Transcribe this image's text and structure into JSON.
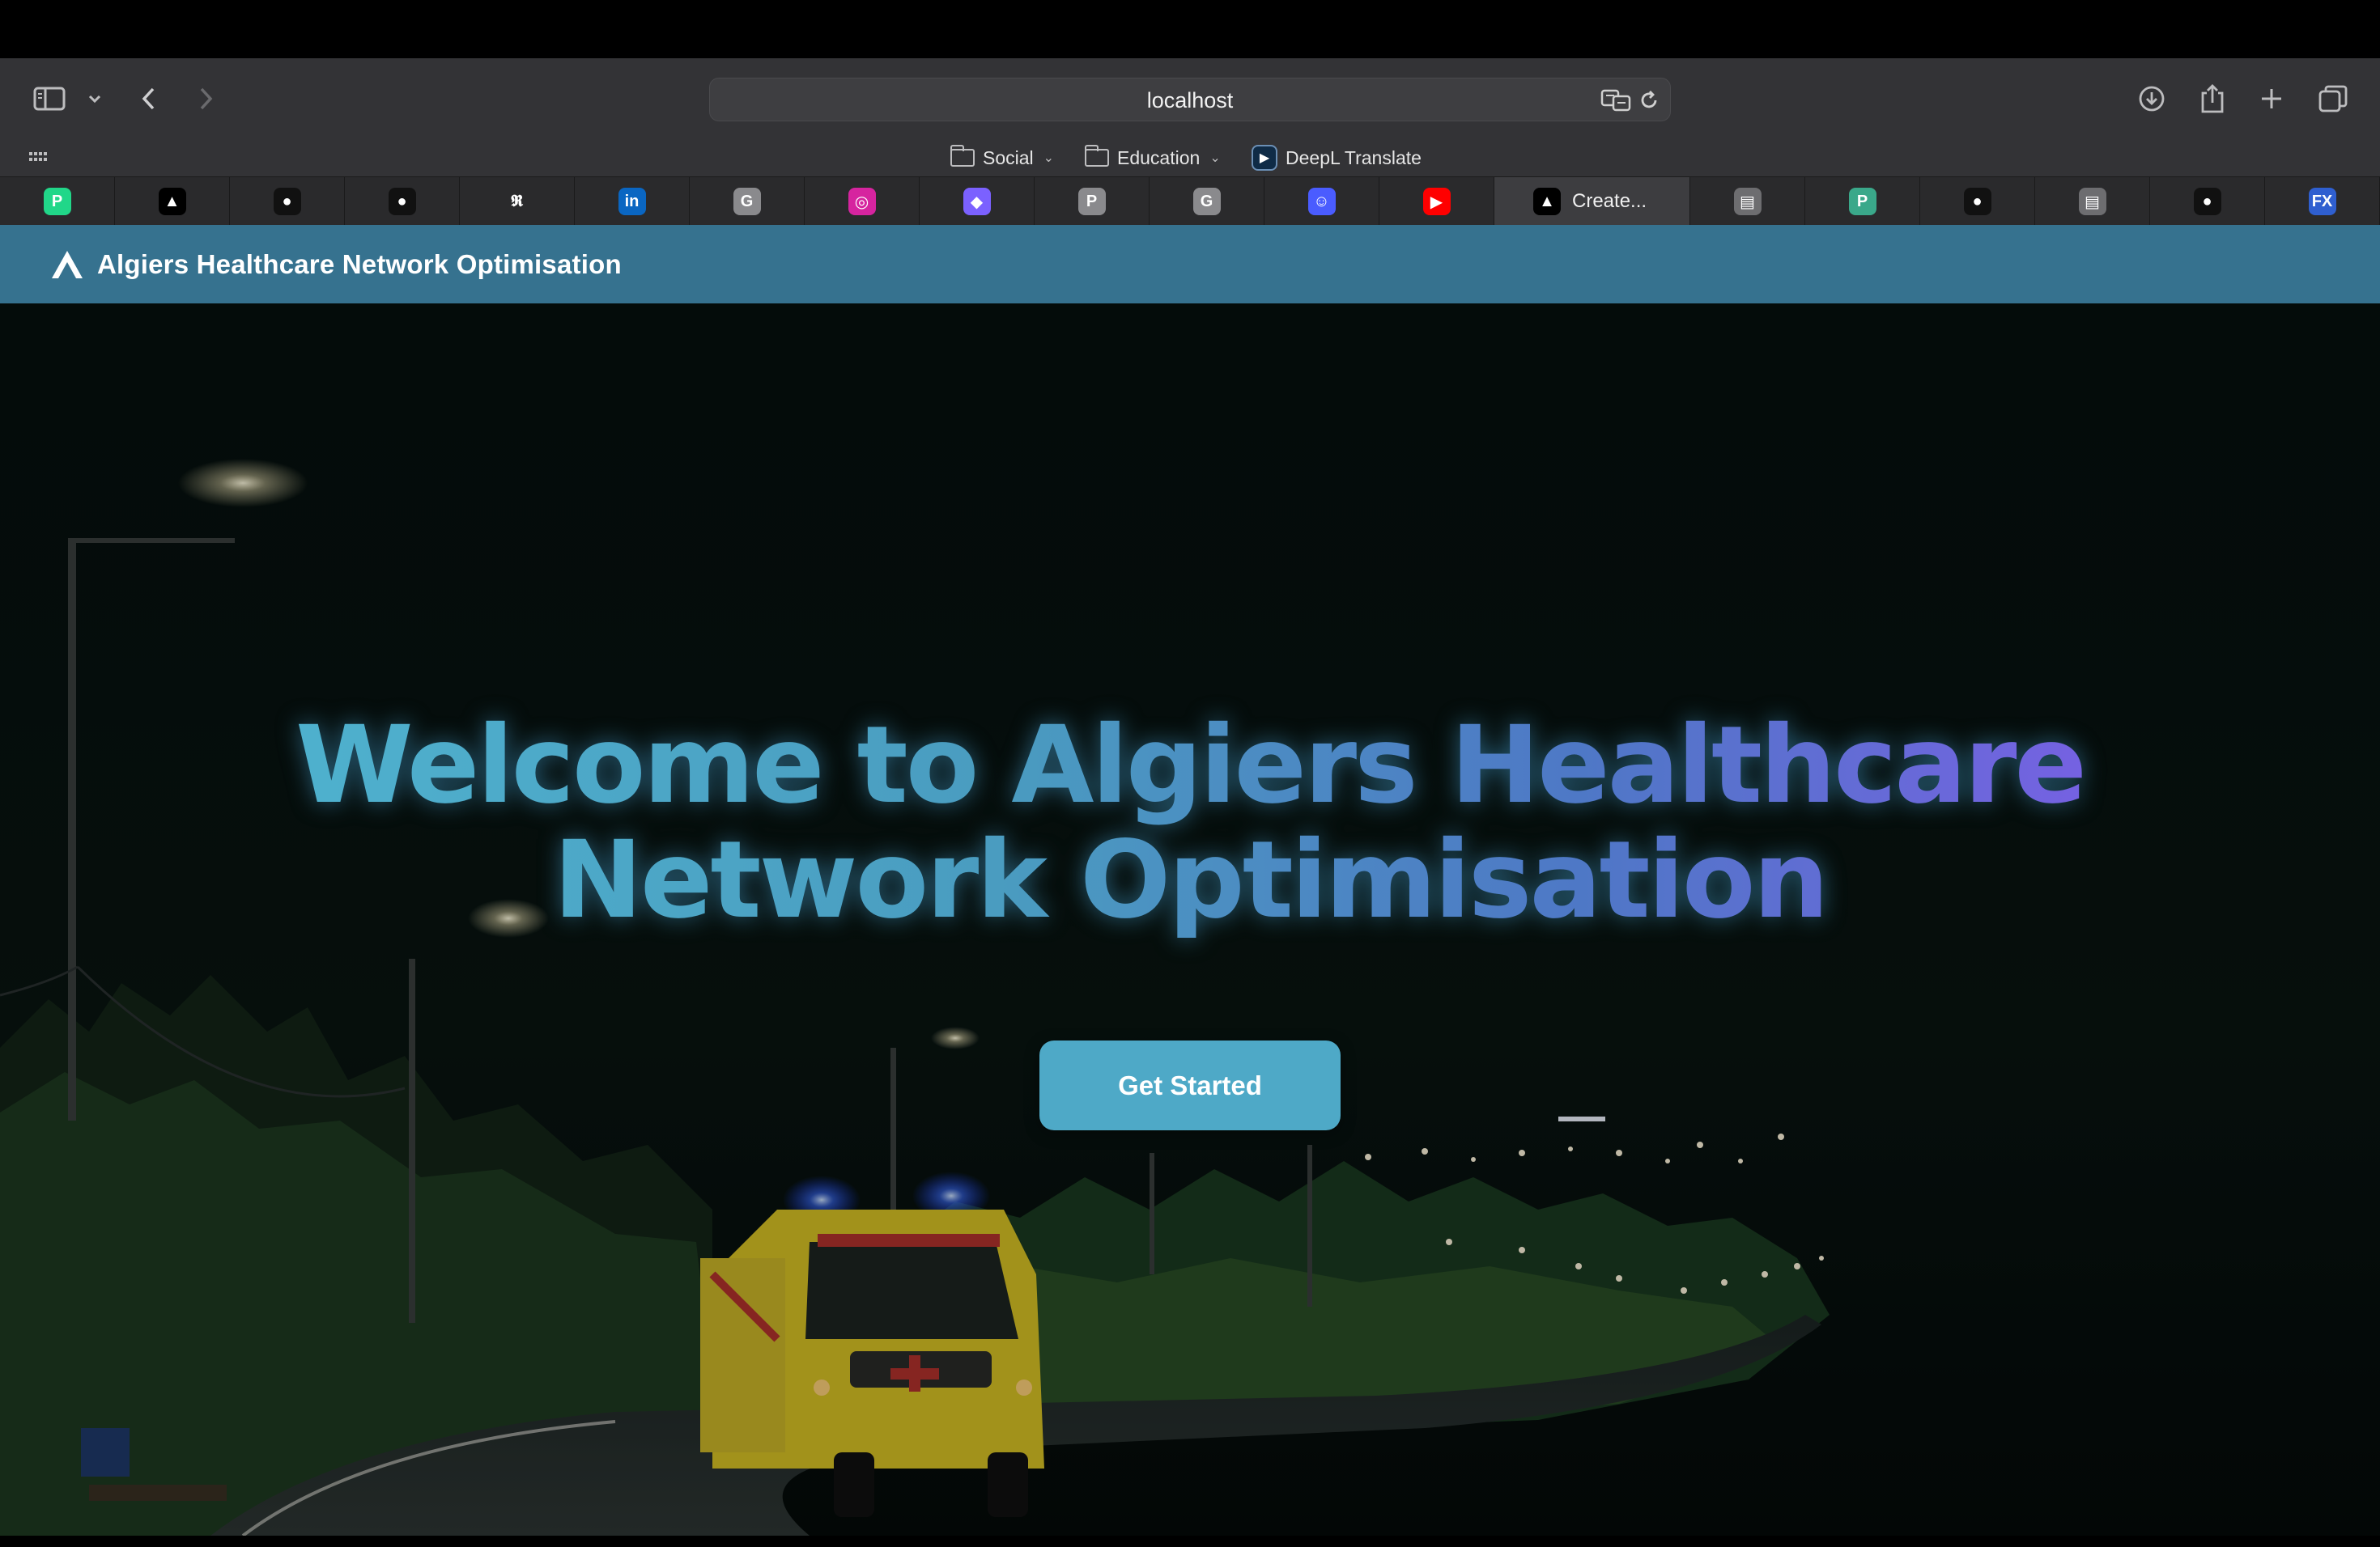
{
  "browser": {
    "url": "localhost",
    "favorites": [
      {
        "label": "Social",
        "type": "folder"
      },
      {
        "label": "Education",
        "type": "folder"
      },
      {
        "label": "DeepL Translate",
        "type": "link"
      }
    ],
    "active_tab_title": "Create...",
    "tab_icons": [
      "pycharm-icon",
      "vercel-icon",
      "github-icon",
      "github-icon",
      "app-icon",
      "linkedin-icon",
      "g-icon",
      "instagram-icon",
      "diamond-icon",
      "p-icon",
      "g-icon",
      "chat-icon",
      "youtube-icon",
      "vercel-icon",
      "reader-icon",
      "p-icon",
      "github-icon",
      "reader-icon",
      "github-icon",
      "fx-icon"
    ]
  },
  "app": {
    "title": "Algiers Healthcare Network Optimisation"
  },
  "hero": {
    "title_line1": "Welcome to Algiers Healthcare",
    "title_line2": "Network Optimisation",
    "cta_label": "Get Started"
  }
}
